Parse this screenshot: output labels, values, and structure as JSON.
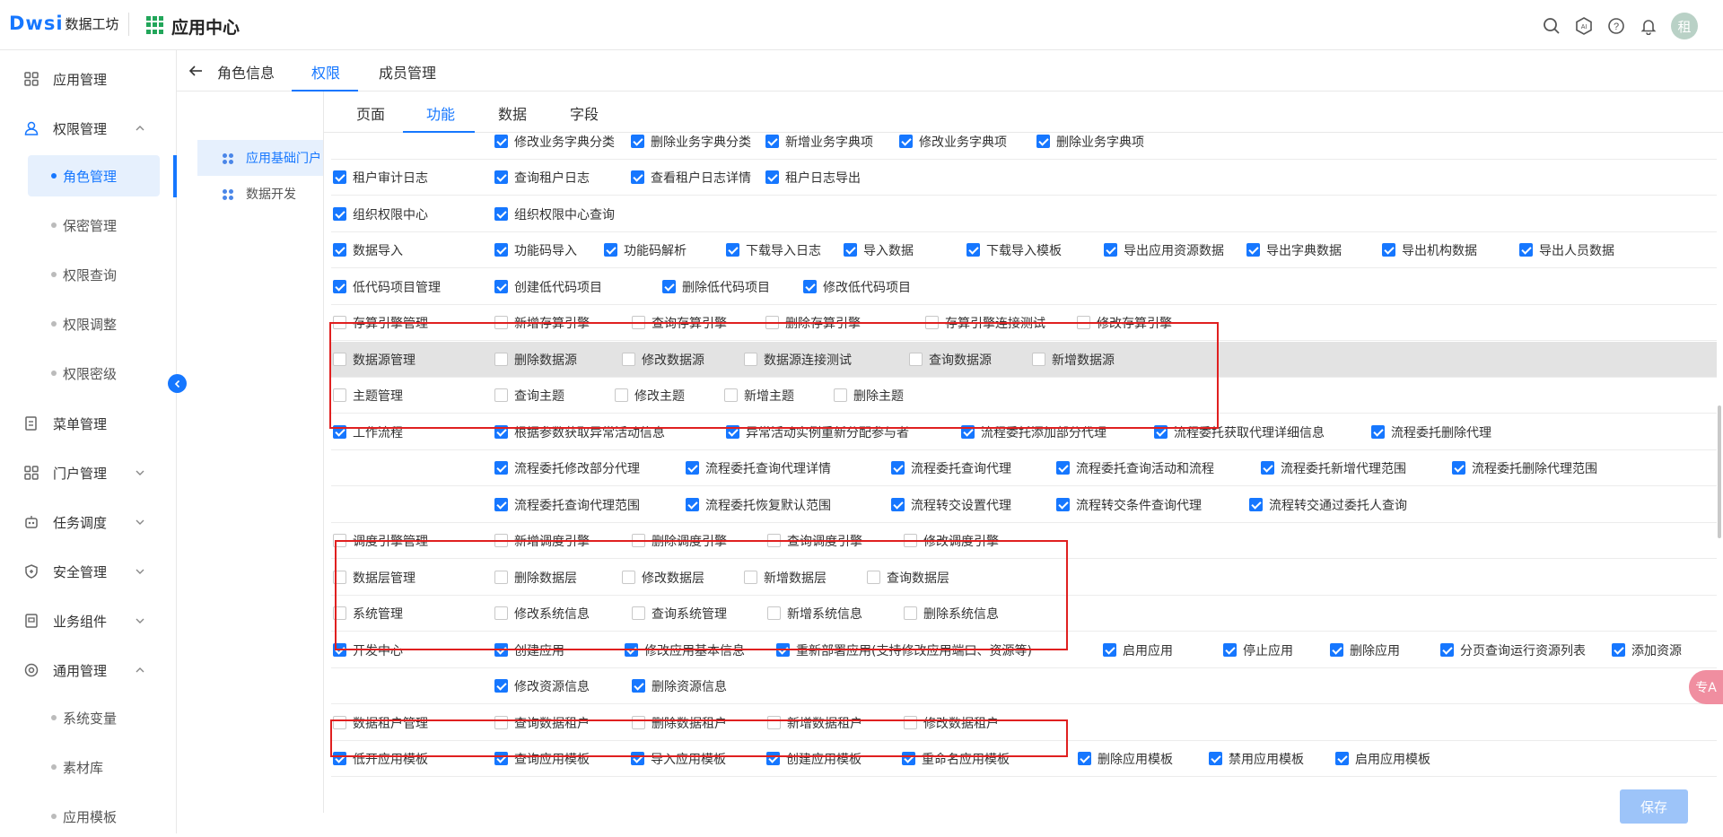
{
  "header": {
    "logo_text": "Dwsi",
    "logo_sub": "数据工坊",
    "app_title": "应用中心",
    "avatar_text": "租"
  },
  "sidebar": {
    "items": [
      {
        "label": "应用管理",
        "icon": "app-grid-icon",
        "top": 0
      },
      {
        "label": "权限管理",
        "icon": "user-lock-icon",
        "expanded": true
      },
      {
        "label": "菜单管理",
        "icon": "menu-doc-icon"
      },
      {
        "label": "门户管理",
        "icon": "portal-grid-icon"
      },
      {
        "label": "任务调度",
        "icon": "robot-icon"
      },
      {
        "label": "安全管理",
        "icon": "shield-icon"
      },
      {
        "label": "业务组件",
        "icon": "component-icon"
      },
      {
        "label": "通用管理",
        "icon": "settings-icon"
      }
    ],
    "perm_sub": [
      "角色管理",
      "保密管理",
      "权限查询",
      "权限调整",
      "权限密级"
    ],
    "general_sub": [
      "系统变量",
      "素材库",
      "应用模板"
    ]
  },
  "tabs": [
    "角色信息",
    "权限",
    "成员管理"
  ],
  "tree": [
    "应用基础门户",
    "数据开发"
  ],
  "subtabs": [
    "页面",
    "功能",
    "数据",
    "字段"
  ],
  "rows": [
    {
      "c": [
        [
          "",
          0
        ],
        [
          "修改业务字典分类",
          1
        ],
        [
          "删除业务字典分类",
          1
        ],
        [
          "新增业务字典项",
          1
        ],
        [
          "修改业务字典项",
          1
        ],
        [
          "删除业务字典项",
          1
        ]
      ]
    },
    {
      "c": [
        [
          "租户审计日志",
          1
        ],
        [
          "查询租户日志",
          1
        ],
        [
          "查看租户日志详情",
          1
        ],
        [
          "租户日志导出",
          1
        ]
      ]
    },
    {
      "c": [
        [
          "组织权限中心",
          1
        ],
        [
          "组织权限中心查询",
          1
        ]
      ]
    },
    {
      "c": [
        [
          "数据导入",
          1
        ],
        [
          "功能码导入",
          1
        ],
        [
          "功能码解析",
          1
        ],
        [
          "下载导入日志",
          1
        ],
        [
          "导入数据",
          1
        ],
        [
          "下载导入模板",
          1
        ],
        [
          "导出应用资源数据",
          1
        ],
        [
          "导出字典数据",
          1
        ],
        [
          "导出机构数据",
          1
        ],
        [
          "导出人员数据",
          1
        ]
      ]
    },
    {
      "c": [
        [
          "低代码项目管理",
          1
        ],
        [
          "创建低代码项目",
          1
        ],
        [
          "删除低代码项目",
          1
        ],
        [
          "修改低代码项目",
          1
        ]
      ]
    },
    {
      "c": [
        [
          "存算引擎管理",
          0
        ],
        [
          "新增存算引擎",
          0
        ],
        [
          "查询存算引擎",
          0
        ],
        [
          "删除存算引擎",
          0
        ],
        [
          "存算引擎连接测试",
          0
        ],
        [
          "修改存算引擎",
          0
        ]
      ]
    },
    {
      "c": [
        [
          "数据源管理",
          0
        ],
        [
          "删除数据源",
          0
        ],
        [
          "修改数据源",
          0
        ],
        [
          "数据源连接测试",
          0
        ],
        [
          "查询数据源",
          0
        ],
        [
          "新增数据源",
          0
        ]
      ]
    },
    {
      "c": [
        [
          "主题管理",
          0
        ],
        [
          "查询主题",
          0
        ],
        [
          "修改主题",
          0
        ],
        [
          "新增主题",
          0
        ],
        [
          "删除主题",
          0
        ]
      ]
    },
    {
      "c": [
        [
          "工作流程",
          1
        ],
        [
          "根据参数获取异常活动信息",
          1
        ],
        [
          "异常活动实例重新分配参与者",
          1
        ],
        [
          "流程委托添加部分代理",
          1
        ],
        [
          "流程委托获取代理详细信息",
          1
        ],
        [
          "流程委托删除代理",
          1
        ]
      ]
    },
    {
      "c": [
        [
          "",
          0
        ],
        [
          "流程委托修改部分代理",
          1
        ],
        [
          "流程委托查询代理详情",
          1
        ],
        [
          "流程委托查询代理",
          1
        ],
        [
          "流程委托查询活动和流程",
          1
        ],
        [
          "流程委托新增代理范围",
          1
        ],
        [
          "流程委托删除代理范围",
          1
        ]
      ]
    },
    {
      "c": [
        [
          "",
          0
        ],
        [
          "流程委托查询代理范围",
          1
        ],
        [
          "流程委托恢复默认范围",
          1
        ],
        [
          "流程转交设置代理",
          1
        ],
        [
          "流程转交条件查询代理",
          1
        ],
        [
          "流程转交通过委托人查询",
          1
        ]
      ]
    },
    {
      "c": [
        [
          "调度引擎管理",
          0
        ],
        [
          "新增调度引擎",
          0
        ],
        [
          "删除调度引擎",
          0
        ],
        [
          "查询调度引擎",
          0
        ],
        [
          "修改调度引擎",
          0
        ]
      ]
    },
    {
      "c": [
        [
          "数据层管理",
          0
        ],
        [
          "删除数据层",
          0
        ],
        [
          "修改数据层",
          0
        ],
        [
          "新增数据层",
          0
        ],
        [
          "查询数据层",
          0
        ]
      ]
    },
    {
      "c": [
        [
          "系统管理",
          0
        ],
        [
          "修改系统信息",
          0
        ],
        [
          "查询系统管理",
          0
        ],
        [
          "新增系统信息",
          0
        ],
        [
          "删除系统信息",
          0
        ]
      ]
    },
    {
      "c": [
        [
          "开发中心",
          1
        ],
        [
          "创建应用",
          1
        ],
        [
          "修改应用基本信息",
          1
        ],
        [
          "重新部署应用(支持修改应用端口、资源等)",
          1
        ],
        [
          "启用应用",
          1
        ],
        [
          "停止应用",
          1
        ],
        [
          "删除应用",
          1
        ],
        [
          "分页查询运行资源列表",
          1
        ],
        [
          "添加资源",
          1
        ]
      ]
    },
    {
      "c": [
        [
          "",
          0
        ],
        [
          "修改资源信息",
          1
        ],
        [
          "删除资源信息",
          1
        ]
      ]
    },
    {
      "c": [
        [
          "数据租户管理",
          0
        ],
        [
          "查询数据租户",
          0
        ],
        [
          "删除数据租户",
          0
        ],
        [
          "新增数据租户",
          0
        ],
        [
          "修改数据租户",
          0
        ]
      ]
    },
    {
      "c": [
        [
          "低开应用模板",
          1
        ],
        [
          "查询应用模板",
          1
        ],
        [
          "导入应用模板",
          1
        ],
        [
          "创建应用模板",
          1
        ],
        [
          "重命名应用模板",
          1
        ],
        [
          "删除应用模板",
          1
        ],
        [
          "禁用应用模板",
          1
        ],
        [
          "启用应用模板",
          1
        ]
      ]
    }
  ],
  "float_btn": "专A",
  "save_label": "保存"
}
